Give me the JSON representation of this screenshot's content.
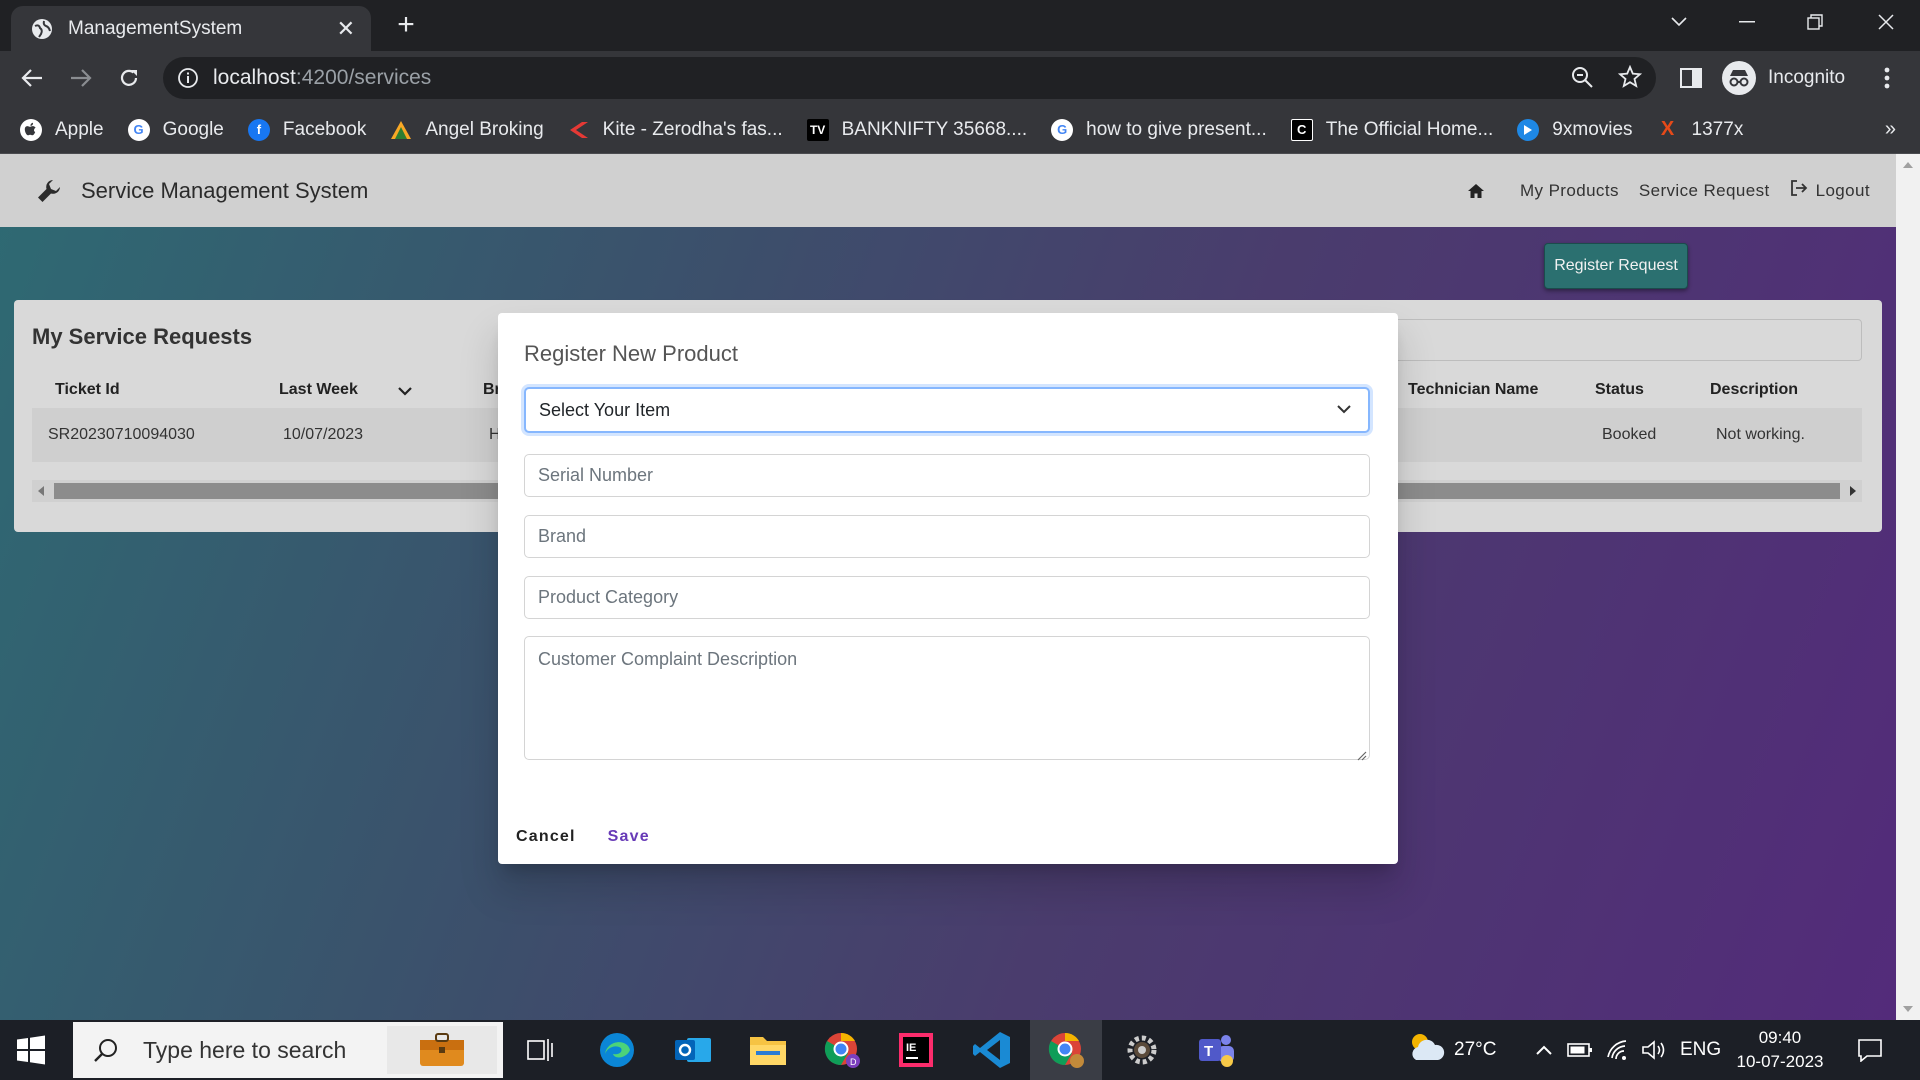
{
  "browser": {
    "tab_title": "ManagementSystem",
    "url_host": "localhost",
    "url_path": ":4200/services",
    "incognito_label": "Incognito",
    "bookmarks": [
      {
        "label": "Apple",
        "icon": "apple-icon",
        "color": "#ffffff"
      },
      {
        "label": "Google",
        "icon": "google-icon",
        "color": "#4285f4"
      },
      {
        "label": "Facebook",
        "icon": "facebook-icon",
        "color": "#1877f2"
      },
      {
        "label": "Angel Broking",
        "icon": "angel-broking-icon",
        "color": "#2e7d32"
      },
      {
        "label": "Kite - Zerodha's fas...",
        "icon": "kite-icon",
        "color": "#e53935"
      },
      {
        "label": "BANKNIFTY 35668....",
        "icon": "tradingview-icon",
        "color": "#000000"
      },
      {
        "label": "how to give present...",
        "icon": "google-icon",
        "color": "#4285f4"
      },
      {
        "label": "The Official Home...",
        "icon": "c-icon",
        "color": "#000000"
      },
      {
        "label": "9xmovies",
        "icon": "play-icon",
        "color": "#1e88e5"
      },
      {
        "label": "1377x",
        "icon": "x-icon",
        "color": "#e64a19"
      }
    ]
  },
  "app": {
    "title": "Service Management System",
    "nav": {
      "my_products": "My Products",
      "service_request": "Service Request",
      "logout": "Logout"
    },
    "register_button": "Register Request",
    "card_title": "My Service Requests",
    "table": {
      "headers": {
        "ticket_id": "Ticket Id",
        "last_week": "Last Week",
        "brand": "Bran",
        "technician_name": "Technician Name",
        "status": "Status",
        "description": "Description"
      },
      "row": {
        "ticket_id": "SR20230710094030",
        "date": "10/07/2023",
        "brand": "HA",
        "status": "Booked",
        "description": "Not working."
      }
    }
  },
  "dialog": {
    "title": "Register New Product",
    "select_value": "Select Your Item",
    "serial_placeholder": "Serial Number",
    "brand_placeholder": "Brand",
    "category_placeholder": "Product Category",
    "complaint_placeholder": "Customer Complaint Description",
    "cancel": "Cancel",
    "save": "Save"
  },
  "taskbar": {
    "search_placeholder": "Type here to search",
    "weather": "27°C",
    "language": "ENG",
    "time": "09:40",
    "date": "10-07-2023"
  },
  "colors": {
    "accent_teal": "#2b7070",
    "save_purple": "#673ab7",
    "focus_blue": "#86b7fe"
  }
}
